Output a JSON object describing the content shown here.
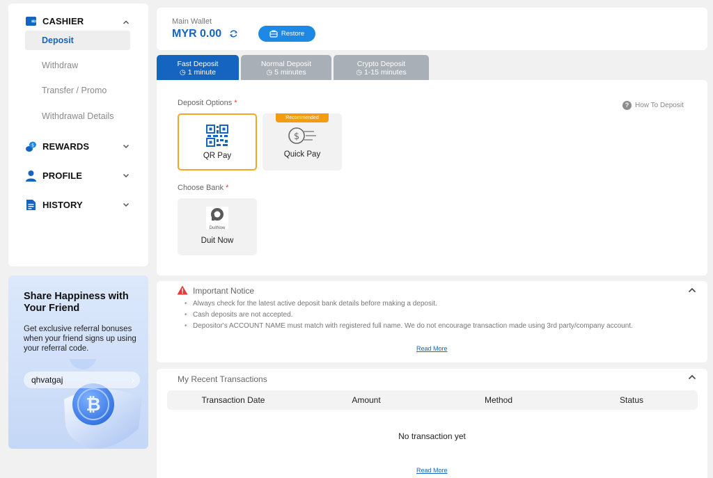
{
  "sidebar": {
    "cashier": {
      "label": "CASHIER"
    },
    "sub_items": [
      "Deposit",
      "Withdraw",
      "Transfer / Promo",
      "Withdrawal Details"
    ],
    "rewards": {
      "label": "REWARDS"
    },
    "profile": {
      "label": "PROFILE"
    },
    "history": {
      "label": "HISTORY"
    }
  },
  "share": {
    "title": "Share Happiness with Your Friend",
    "text": "Get exclusive referral bonuses when your friend signs up using your referral code.",
    "code": "qhvatgaj"
  },
  "wallet": {
    "label": "Main Wallet",
    "amount": "MYR 0.00",
    "restore_label": "Restore"
  },
  "tabs": [
    {
      "title": "Fast Deposit",
      "time": "1 minute"
    },
    {
      "title": "Normal Deposit",
      "time": "5 minutes"
    },
    {
      "title": "Crypto Deposit",
      "time": "1-15 minutes"
    }
  ],
  "deposit": {
    "options_label": "Deposit Options",
    "how_to": "How To Deposit",
    "options": [
      {
        "label": "QR Pay"
      },
      {
        "label": "Quick Pay",
        "badge": "Recommended"
      }
    ],
    "bank_label": "Choose Bank",
    "bank": {
      "label": "Duit Now",
      "logo_text": "DuitNow"
    }
  },
  "notice": {
    "title": "Important Notice",
    "items": [
      "Always check for the latest active deposit bank details before making a deposit.",
      "Cash deposits are not accepted.",
      "Depositor's ACCOUNT NAME must match with registered full name. We do not encourage transaction made using 3rd party/company account."
    ],
    "read_more": "Read More"
  },
  "transactions": {
    "title": "My Recent Transactions",
    "columns": [
      "Transaction Date",
      "Amount",
      "Method",
      "Status"
    ],
    "empty": "No transaction yet",
    "read_more": "Read More"
  },
  "colors": {
    "primary": "#1565c0",
    "accent": "#f5a623",
    "tab_inactive": "#a9afb7"
  }
}
